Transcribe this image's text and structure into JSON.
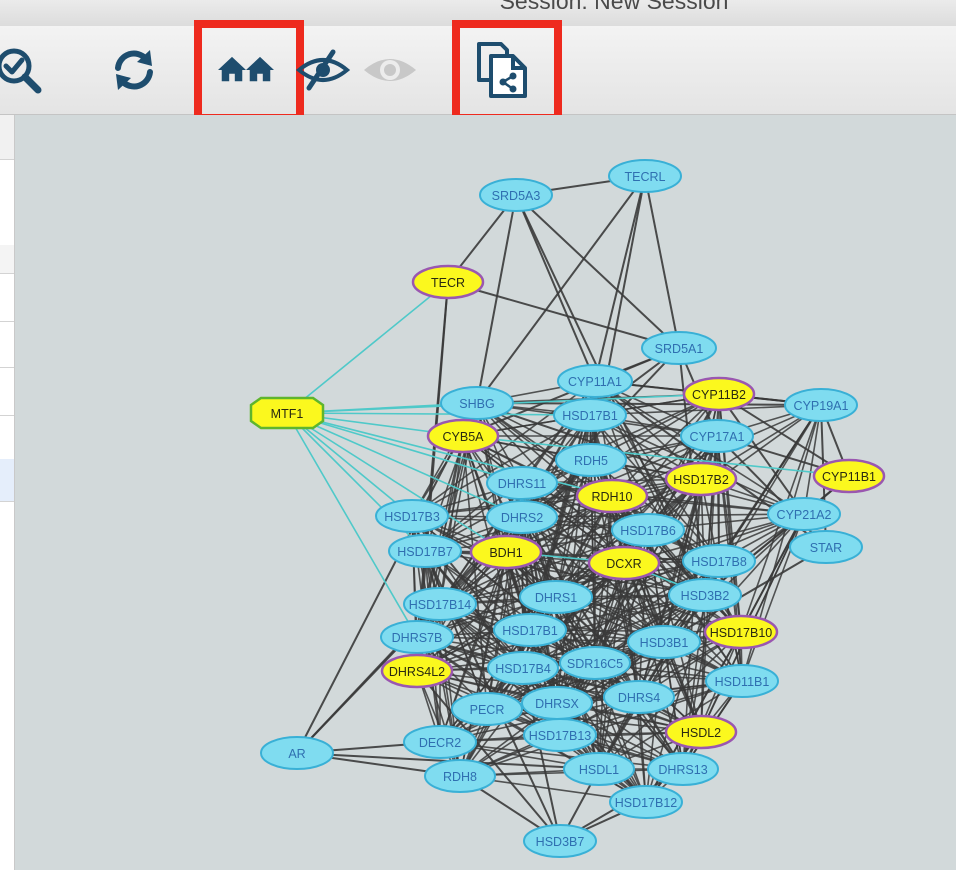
{
  "window": {
    "title": "Session: New Session"
  },
  "toolbar": {
    "tools": [
      {
        "name": "zoom-selected",
        "icon": "zoom-check-icon",
        "highlighted": false,
        "enabled": true
      },
      {
        "name": "refresh",
        "icon": "refresh-icon",
        "highlighted": false,
        "enabled": true
      },
      {
        "name": "first-neighbors",
        "icon": "houses-icon",
        "highlighted": true,
        "enabled": true
      },
      {
        "name": "hide-selected",
        "icon": "eye-hide-icon",
        "highlighted": false,
        "enabled": true
      },
      {
        "name": "show-all",
        "icon": "eye-icon",
        "highlighted": false,
        "enabled": false
      },
      {
        "name": "new-network-from-selection",
        "icon": "network-documents-icon",
        "highlighted": true,
        "enabled": true
      }
    ]
  },
  "colors": {
    "highlight_box": "#ee2a1e",
    "canvas_bg": "#d2d9da",
    "node_cyan": "#7fdcf0",
    "node_yellow": "#fbf81e",
    "edge_dark": "#3a3a3a",
    "edge_cyan": "#4fc9c9"
  },
  "network": {
    "nodes": [
      {
        "id": "TECRL",
        "label": "TECRL",
        "shape": "ellipse",
        "color": "cyan"
      },
      {
        "id": "SRD5A3",
        "label": "SRD5A3",
        "shape": "ellipse",
        "color": "cyan"
      },
      {
        "id": "TECR",
        "label": "TECR",
        "shape": "ellipse",
        "color": "yellow"
      },
      {
        "id": "SRD5A1",
        "label": "SRD5A1",
        "shape": "ellipse",
        "color": "cyan"
      },
      {
        "id": "MTF1",
        "label": "MTF1",
        "shape": "octagon",
        "color": "yellow"
      },
      {
        "id": "CYP11A1",
        "label": "CYP11A1",
        "shape": "ellipse",
        "color": "cyan"
      },
      {
        "id": "CYP11B2",
        "label": "CYP11B2",
        "shape": "ellipse",
        "color": "yellow"
      },
      {
        "id": "CYP19A1",
        "label": "CYP19A1",
        "shape": "ellipse",
        "color": "cyan"
      },
      {
        "id": "SHBG",
        "label": "SHBG",
        "shape": "ellipse",
        "color": "cyan"
      },
      {
        "id": "HSD17B1a",
        "label": "HSD17B1",
        "shape": "ellipse",
        "color": "cyan"
      },
      {
        "id": "CYB5A",
        "label": "CYB5A",
        "shape": "ellipse",
        "color": "yellow"
      },
      {
        "id": "CYP17A1",
        "label": "CYP17A1",
        "shape": "ellipse",
        "color": "cyan"
      },
      {
        "id": "RDH5",
        "label": "RDH5",
        "shape": "ellipse",
        "color": "cyan"
      },
      {
        "id": "CYP11B1",
        "label": "CYP11B1",
        "shape": "ellipse",
        "color": "yellow"
      },
      {
        "id": "HSD17B2",
        "label": "HSD17B2",
        "shape": "ellipse",
        "color": "yellow"
      },
      {
        "id": "DHRS11",
        "label": "DHRS11",
        "shape": "ellipse",
        "color": "cyan"
      },
      {
        "id": "RDH10",
        "label": "RDH10",
        "shape": "ellipse",
        "color": "yellow"
      },
      {
        "id": "CYP21A2",
        "label": "CYP21A2",
        "shape": "ellipse",
        "color": "cyan"
      },
      {
        "id": "HSD17B3",
        "label": "HSD17B3",
        "shape": "ellipse",
        "color": "cyan"
      },
      {
        "id": "DHRS2",
        "label": "DHRS2",
        "shape": "ellipse",
        "color": "cyan"
      },
      {
        "id": "HSD17B6",
        "label": "HSD17B6",
        "shape": "ellipse",
        "color": "cyan"
      },
      {
        "id": "STAR",
        "label": "STAR",
        "shape": "ellipse",
        "color": "cyan"
      },
      {
        "id": "HSD17B7",
        "label": "HSD17B7",
        "shape": "ellipse",
        "color": "cyan"
      },
      {
        "id": "BDH1",
        "label": "BDH1",
        "shape": "ellipse",
        "color": "yellow"
      },
      {
        "id": "DCXR",
        "label": "DCXR",
        "shape": "ellipse",
        "color": "yellow"
      },
      {
        "id": "HSD17B8",
        "label": "HSD17B8",
        "shape": "ellipse",
        "color": "cyan"
      },
      {
        "id": "HSD3B2",
        "label": "HSD3B2",
        "shape": "ellipse",
        "color": "cyan"
      },
      {
        "id": "DHRS1",
        "label": "DHRS1",
        "shape": "ellipse",
        "color": "cyan"
      },
      {
        "id": "HSD17B14",
        "label": "HSD17B14",
        "shape": "ellipse",
        "color": "cyan"
      },
      {
        "id": "HSD17B1b",
        "label": "HSD17B1",
        "shape": "ellipse",
        "color": "cyan"
      },
      {
        "id": "HSD17B10",
        "label": "HSD17B10",
        "shape": "ellipse",
        "color": "yellow"
      },
      {
        "id": "DHRS7B",
        "label": "DHRS7B",
        "shape": "ellipse",
        "color": "cyan"
      },
      {
        "id": "HSD3B1",
        "label": "HSD3B1",
        "shape": "ellipse",
        "color": "cyan"
      },
      {
        "id": "DHRS4L2",
        "label": "DHRS4L2",
        "shape": "ellipse",
        "color": "yellow"
      },
      {
        "id": "HSD17B4",
        "label": "HSD17B4",
        "shape": "ellipse",
        "color": "cyan"
      },
      {
        "id": "SDR16C5",
        "label": "SDR16C5",
        "shape": "ellipse",
        "color": "cyan"
      },
      {
        "id": "HSD11B1",
        "label": "HSD11B1",
        "shape": "ellipse",
        "color": "cyan"
      },
      {
        "id": "DHRS4",
        "label": "DHRS4",
        "shape": "ellipse",
        "color": "cyan"
      },
      {
        "id": "PECR",
        "label": "PECR",
        "shape": "ellipse",
        "color": "cyan"
      },
      {
        "id": "DHRSX",
        "label": "DHRSX",
        "shape": "ellipse",
        "color": "cyan"
      },
      {
        "id": "HSDL2",
        "label": "HSDL2",
        "shape": "ellipse",
        "color": "yellow"
      },
      {
        "id": "AR",
        "label": "AR",
        "shape": "ellipse",
        "color": "cyan"
      },
      {
        "id": "DECR2",
        "label": "DECR2",
        "shape": "ellipse",
        "color": "cyan"
      },
      {
        "id": "HSD17B13",
        "label": "HSD17B13",
        "shape": "ellipse",
        "color": "cyan"
      },
      {
        "id": "HSDL1",
        "label": "HSDL1",
        "shape": "ellipse",
        "color": "cyan"
      },
      {
        "id": "DHRS13",
        "label": "DHRS13",
        "shape": "ellipse",
        "color": "cyan"
      },
      {
        "id": "RDH8",
        "label": "RDH8",
        "shape": "ellipse",
        "color": "cyan"
      },
      {
        "id": "HSD17B12",
        "label": "HSD17B12",
        "shape": "ellipse",
        "color": "cyan"
      },
      {
        "id": "HSD3B7",
        "label": "HSD3B7",
        "shape": "ellipse",
        "color": "cyan"
      }
    ],
    "edges_cyan": [
      [
        "MTF1",
        "TECR"
      ],
      [
        "MTF1",
        "SHBG"
      ],
      [
        "MTF1",
        "CYB5A"
      ],
      [
        "MTF1",
        "HSD17B1a"
      ],
      [
        "MTF1",
        "DHRS11"
      ],
      [
        "MTF1",
        "DHRS2"
      ],
      [
        "MTF1",
        "RDH10"
      ],
      [
        "MTF1",
        "HSD17B3"
      ],
      [
        "MTF1",
        "DHRS7B"
      ],
      [
        "MTF1",
        "CYP11B2"
      ],
      [
        "MTF1",
        "HSD17B7"
      ],
      [
        "CYB5A",
        "CYP11B1"
      ],
      [
        "BDH1",
        "DCXR"
      ],
      [
        "DCXR",
        "HSD3B2"
      ],
      [
        "MTF1",
        "BDH1"
      ]
    ],
    "edges_dark": [
      [
        "SRD5A3",
        "TECRL"
      ],
      [
        "SRD5A3",
        "TECR"
      ],
      [
        "SRD5A3",
        "SRD5A1"
      ],
      [
        "SRD5A3",
        "CYP11A1"
      ],
      [
        "SRD5A3",
        "HSD3B2"
      ],
      [
        "SRD5A3",
        "SHBG"
      ],
      [
        "TECRL",
        "SRD5A1"
      ],
      [
        "TECRL",
        "CYP11A1"
      ],
      [
        "TECRL",
        "SHBG"
      ],
      [
        "TECRL",
        "RDH5"
      ],
      [
        "TECR",
        "SRD5A1"
      ],
      [
        "TECR",
        "DHRS4L2"
      ],
      [
        "TECR",
        "HSD17B7"
      ],
      [
        "SRD5A1",
        "CYP11A1"
      ],
      [
        "SRD5A1",
        "HSD17B1a"
      ],
      [
        "SRD5A1",
        "CYP17A1"
      ],
      [
        "SRD5A1",
        "HSD3B2"
      ],
      [
        "SRD5A1",
        "AR"
      ],
      [
        "SRD5A1",
        "CYB5A"
      ],
      [
        "SHBG",
        "CYP19A1"
      ],
      [
        "SHBG",
        "HSD17B2"
      ],
      [
        "SHBG",
        "AR"
      ],
      [
        "CYP11A1",
        "CYP19A1"
      ],
      [
        "CYP11A1",
        "STAR"
      ],
      [
        "CYP11B2",
        "CYP19A1"
      ],
      [
        "CYP11B2",
        "CYP11B1"
      ],
      [
        "CYP11B2",
        "CYP21A2"
      ],
      [
        "CYP19A1",
        "CYP11B1"
      ],
      [
        "CYP19A1",
        "STAR"
      ],
      [
        "CYP17A1",
        "CYP11B1"
      ],
      [
        "CYP17A1",
        "STAR"
      ],
      [
        "CYP21A2",
        "CYP11B1"
      ],
      [
        "AR",
        "DECR2"
      ],
      [
        "AR",
        "HSD17B14"
      ],
      [
        "AR",
        "RDH8"
      ],
      [
        "AR",
        "HSDL1"
      ],
      [
        "DHRS4L2",
        "HSD3B7"
      ],
      [
        "HSD17B7",
        "HSD3B7"
      ],
      [
        "HSD17B3",
        "HSD17B12"
      ],
      [
        "HSD3B7",
        "HSDL1"
      ],
      [
        "HSD3B7",
        "HSD17B12"
      ],
      [
        "HSD3B7",
        "DHRS13"
      ],
      [
        "HSD3B7",
        "RDH8"
      ],
      [
        "HSD3B7",
        "HSD17B4"
      ],
      [
        "HSD17B10",
        "HSD17B12"
      ],
      [
        "HSD11B1",
        "DHRS13"
      ],
      [
        "HSDL2",
        "HSD17B12"
      ],
      [
        "STAR",
        "HSD3B1"
      ],
      [
        "CYP21A2",
        "HSD17B10"
      ],
      [
        "CYP19A1",
        "HSD17B8"
      ],
      [
        "CYP11B1",
        "HSD3B2"
      ]
    ],
    "dense_cluster": [
      "SHBG",
      "HSD17B1a",
      "CYB5A",
      "CYP17A1",
      "RDH5",
      "HSD17B2",
      "DHRS11",
      "RDH10",
      "CYP21A2",
      "HSD17B3",
      "DHRS2",
      "HSD17B6",
      "HSD17B7",
      "BDH1",
      "DCXR",
      "HSD17B8",
      "HSD3B2",
      "DHRS1",
      "HSD17B14",
      "HSD17B1b",
      "HSD17B10",
      "DHRS7B",
      "HSD3B1",
      "DHRS4L2",
      "HSD17B4",
      "SDR16C5",
      "HSD11B1",
      "DHRS4",
      "PECR",
      "DHRSX",
      "HSDL2",
      "DECR2",
      "HSD17B13",
      "HSDL1",
      "DHRS13",
      "RDH8",
      "HSD17B12",
      "CYP11A1",
      "CYP11B2",
      "CYP19A1"
    ]
  }
}
